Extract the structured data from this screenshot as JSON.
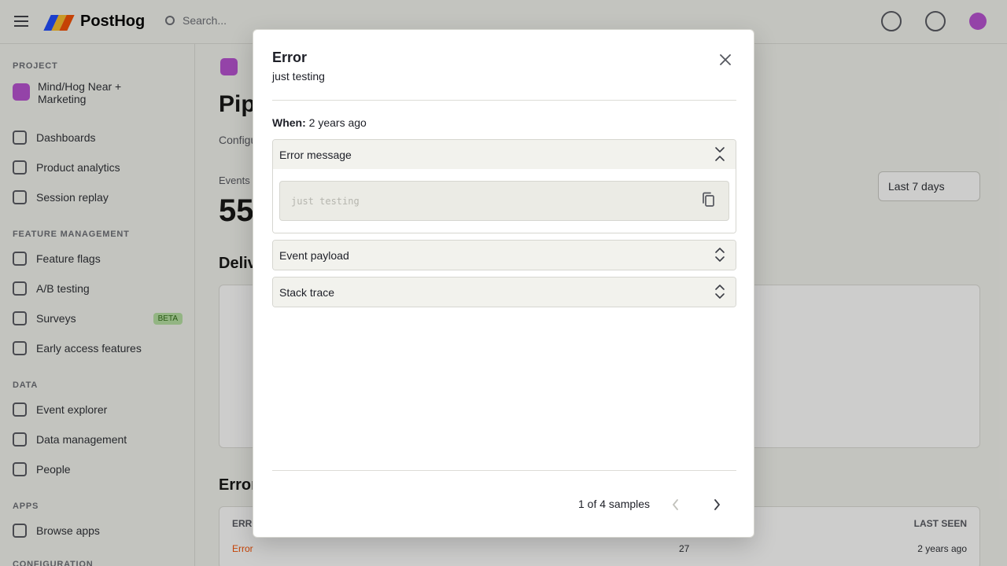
{
  "app": {
    "brand": "PostHog",
    "search_placeholder": "Search..."
  },
  "sidebar": {
    "project_label": "PROJECT",
    "project_name": "Mind/Hog Near + Marketing",
    "items_top": [
      {
        "label": "Dashboards"
      },
      {
        "label": "Product analytics"
      },
      {
        "label": "Session replay"
      }
    ],
    "feature_section": "FEATURE MANAGEMENT",
    "items_feature": [
      {
        "label": "Feature flags"
      },
      {
        "label": "A/B testing"
      },
      {
        "label": "Surveys",
        "badge": "BETA"
      },
      {
        "label": "Early access features"
      }
    ],
    "data_section": "DATA",
    "items_data": [
      {
        "label": "Event explorer"
      },
      {
        "label": "Data management"
      },
      {
        "label": "People"
      }
    ],
    "apps_section": "APPS",
    "items_apps": [
      {
        "label": "Browse apps"
      }
    ],
    "config_section": "CONFIGURATION"
  },
  "main": {
    "page_title": "Pipeline",
    "page_subtitle": "Configuration",
    "events_label": "Events",
    "big_number": "55",
    "range": "Last 7 days",
    "delivery_heading": "Delivery",
    "errors_heading": "Errors",
    "table": {
      "headers": [
        "ERROR",
        "LAST SEEN"
      ],
      "row": {
        "error": "Error",
        "count": "27",
        "last_seen": "2 years ago"
      }
    }
  },
  "modal": {
    "title": "Error",
    "subtitle": "just testing",
    "when_label": "When:",
    "when_value": "2 years ago",
    "panels": [
      {
        "label": "Error message",
        "expanded": true,
        "content": "just testing"
      },
      {
        "label": "Event payload",
        "expanded": false
      },
      {
        "label": "Stack trace",
        "expanded": false
      }
    ],
    "pagination": "1 of 4 samples"
  },
  "colors": {
    "accent_purple": "#b64fd1",
    "modal_panel_head": "#f2f2ed",
    "code_bg": "#ebebe5"
  }
}
